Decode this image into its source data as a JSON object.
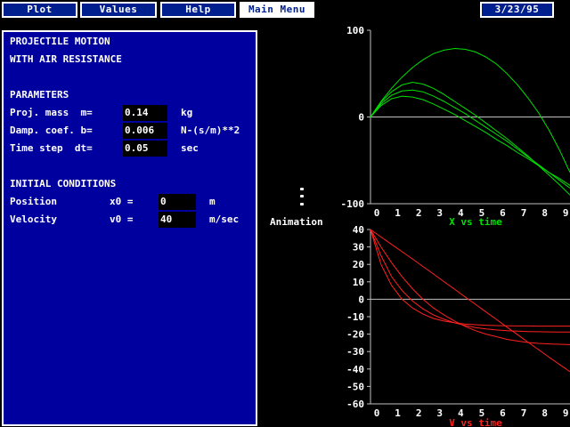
{
  "menu": {
    "plot": "Plot",
    "values": "Values",
    "help": "Help",
    "main_menu": "Main Menu",
    "date": "3/23/95"
  },
  "panel": {
    "title_line1": "PROJECTILE MOTION",
    "title_line2": "WITH AIR RESISTANCE",
    "parameters_heading": "PARAMETERS",
    "params": [
      {
        "label": "Proj. mass  m=",
        "value": "0.14",
        "unit": "kg"
      },
      {
        "label": "Damp. coef. b=",
        "value": "0.006",
        "unit": "N-(s/m)**2"
      },
      {
        "label": "Time step  dt=",
        "value": "0.05",
        "unit": "sec"
      }
    ],
    "initial_heading": "INITIAL CONDITIONS",
    "initial": [
      {
        "label": "Position",
        "symbol": "x0 =",
        "value": "0",
        "unit": "m"
      },
      {
        "label": "Velocity",
        "symbol": "v0 =",
        "value": "40",
        "unit": "m/sec"
      }
    ]
  },
  "animation": {
    "label": "Animation"
  },
  "colors": {
    "menu_bg": "#001f8f",
    "panel_bg": "#00009f",
    "x_curve": "#00e000",
    "v_curve": "#ff2020",
    "axis": "#c0c0c0"
  },
  "chart_data": [
    {
      "type": "line",
      "title": "X vs time",
      "xlabel": "",
      "ylabel": "",
      "xlim": [
        0,
        9.5
      ],
      "ylim": [
        -100,
        100
      ],
      "x_ticks": [
        0,
        1,
        2,
        3,
        4,
        5,
        6,
        7,
        8,
        9
      ],
      "y_ticks": [
        100,
        0,
        -100
      ],
      "grid": false,
      "series": [
        {
          "x": [
            0,
            0.5,
            1,
            1.5,
            2,
            2.5,
            3,
            3.5,
            4,
            4.5,
            5,
            5.5,
            6,
            6.5,
            7,
            7.5,
            8,
            8.5,
            9,
            9.5
          ],
          "values": [
            0,
            18,
            33,
            46,
            57,
            66,
            73,
            77,
            79,
            78,
            75,
            69,
            61,
            50,
            37,
            22,
            5,
            -15,
            -38,
            -64
          ]
        },
        {
          "x": [
            0,
            0.5,
            1,
            1.5,
            2,
            2.5,
            3,
            3.5,
            4,
            4.5,
            5,
            5.5,
            6,
            6.5,
            7,
            7.5,
            8,
            8.5,
            9,
            9.5
          ],
          "values": [
            0,
            17,
            29,
            37,
            40,
            38,
            33,
            26,
            18,
            10,
            2,
            -7,
            -16,
            -25,
            -35,
            -45,
            -56,
            -67,
            -78,
            -90
          ]
        },
        {
          "x": [
            0,
            0.5,
            1,
            1.5,
            2,
            2.5,
            3,
            3.5,
            4,
            4.5,
            5,
            5.5,
            6,
            6.5,
            7,
            7.5,
            8,
            8.5,
            9,
            9.5
          ],
          "values": [
            0,
            15,
            25,
            30,
            31,
            29,
            24,
            18,
            11,
            4,
            -4,
            -12,
            -20,
            -28,
            -37,
            -46,
            -55,
            -64,
            -73,
            -82
          ]
        },
        {
          "x": [
            0,
            0.5,
            1,
            1.5,
            2,
            2.5,
            3,
            3.5,
            4,
            4.5,
            5,
            5.5,
            6,
            6.5,
            7,
            7.5,
            8,
            8.5,
            9,
            9.5
          ],
          "values": [
            0,
            13,
            21,
            24,
            23,
            20,
            15,
            9,
            3,
            -4,
            -11,
            -18,
            -26,
            -33,
            -41,
            -48,
            -56,
            -64,
            -71,
            -79
          ]
        }
      ]
    },
    {
      "type": "line",
      "title": "V vs time",
      "xlabel": "",
      "ylabel": "",
      "xlim": [
        0,
        9.5
      ],
      "ylim": [
        -60,
        40
      ],
      "x_ticks": [
        0,
        1,
        2,
        3,
        4,
        5,
        6,
        7,
        8,
        9
      ],
      "y_ticks": [
        40,
        30,
        20,
        10,
        0,
        -10,
        -20,
        -30,
        -40,
        -50,
        -60
      ],
      "grid": false,
      "series": [
        {
          "x": [
            0,
            0.5,
            1,
            1.5,
            2,
            2.5,
            3,
            3.5,
            4,
            4.5,
            5,
            5.5,
            6,
            6.5,
            7,
            7.5,
            8,
            8.5,
            9,
            9.5
          ],
          "values": [
            40,
            35.7,
            31.5,
            27.3,
            23.1,
            18.8,
            14.5,
            10.1,
            5.8,
            1.4,
            -2.9,
            -7.3,
            -11.6,
            -16.0,
            -20.3,
            -24.6,
            -28.9,
            -33.2,
            -37.4,
            -41.6
          ]
        },
        {
          "x": [
            0,
            0.5,
            1,
            1.5,
            2,
            2.5,
            3,
            3.5,
            4,
            4.5,
            5,
            5.5,
            6,
            6.5,
            7,
            7.5,
            8,
            8.5,
            9,
            9.5
          ],
          "values": [
            40,
            30,
            21,
            13,
            6,
            0,
            -5,
            -9,
            -12.5,
            -15.5,
            -18,
            -20,
            -21.5,
            -23,
            -24,
            -24.8,
            -25.3,
            -25.6,
            -25.8,
            -26
          ]
        },
        {
          "x": [
            0,
            0.5,
            1,
            1.5,
            2,
            2.5,
            3,
            3.5,
            4,
            4.5,
            5,
            5.5,
            6,
            6.5,
            7,
            7.5,
            8,
            8.5,
            9,
            9.5
          ],
          "values": [
            40,
            25,
            13,
            5,
            -1,
            -5.5,
            -9,
            -11.5,
            -13.5,
            -15,
            -16.2,
            -17,
            -17.6,
            -18,
            -18.3,
            -18.5,
            -18.6,
            -18.7,
            -18.8,
            -18.8
          ]
        },
        {
          "x": [
            0,
            0.5,
            1,
            1.5,
            2,
            2.5,
            3,
            3.5,
            4,
            4.5,
            5,
            5.5,
            6,
            6.5,
            7,
            7.5,
            8,
            8.5,
            9,
            9.5
          ],
          "values": [
            40,
            20,
            8,
            0,
            -5,
            -8.5,
            -11,
            -12.5,
            -13.5,
            -14.2,
            -14.6,
            -14.9,
            -15.1,
            -15.2,
            -15.3,
            -15.3,
            -15.4,
            -15.4,
            -15.4,
            -15.4
          ]
        }
      ]
    }
  ]
}
